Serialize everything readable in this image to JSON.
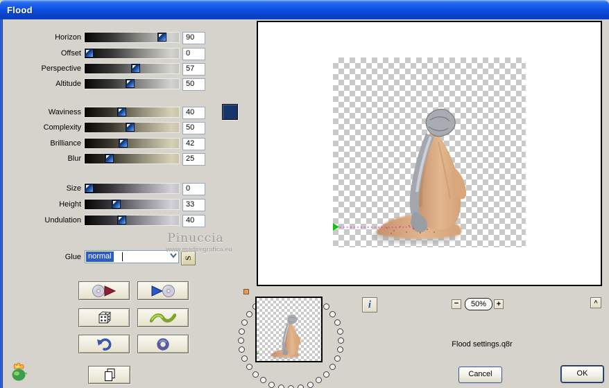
{
  "window": {
    "title": "Flood"
  },
  "sliders": {
    "groups": [
      {
        "items": [
          {
            "label": "Horizon",
            "value": "90"
          },
          {
            "label": "Offset",
            "value": "0"
          },
          {
            "label": "Perspective",
            "value": "57"
          },
          {
            "label": "Altitude",
            "value": "50"
          }
        ]
      },
      {
        "items": [
          {
            "label": "Waviness",
            "value": "40"
          },
          {
            "label": "Complexity",
            "value": "50"
          },
          {
            "label": "Brilliance",
            "value": "42"
          },
          {
            "label": "Blur",
            "value": "25"
          }
        ]
      },
      {
        "items": [
          {
            "label": "Size",
            "value": "0"
          },
          {
            "label": "Height",
            "value": "33"
          },
          {
            "label": "Undulation",
            "value": "40"
          }
        ]
      }
    ]
  },
  "swatch_color": "#15356b",
  "glue": {
    "label": "Glue",
    "value": "normal",
    "s_glyph": "S"
  },
  "watermark": {
    "line1": "Pinuccia",
    "line2": "www.madiregrafica.eu"
  },
  "info_glyph": "i",
  "zoom": {
    "minus": "−",
    "level": "50%",
    "plus": "+",
    "collapse": "^"
  },
  "settings_filename": "Flood settings.q8r",
  "actions": {
    "cancel": "Cancel",
    "ok": "OK"
  },
  "icons": {
    "load_button": "cd-disc-red-play-icon",
    "save_button": "blue-play-cd-disc-icon",
    "random_button": "dice-icon",
    "wave_button": "green-wave-icon",
    "undo_button": "undo-arrow-icon",
    "ring_button": "blue-ring-icon",
    "copy_button": "copy-pages-icon",
    "logo": "flaming-pear-logo",
    "dropdown": "chevron-down-icon",
    "info": "info-icon"
  }
}
